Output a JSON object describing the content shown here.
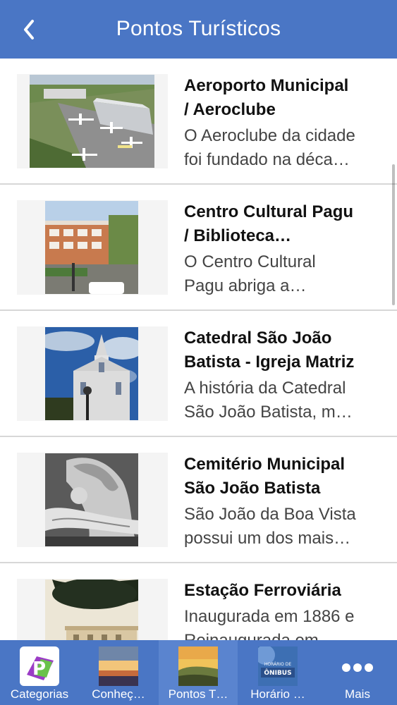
{
  "header": {
    "title": "Pontos Turísticos",
    "back_icon": "chevron-left-icon"
  },
  "items": [
    {
      "title_l1": "Aeroporto Municipal",
      "title_l2": "/ Aeroclube",
      "desc_l1": "O Aeroclube da cidade",
      "desc_l2": "foi fundado na déca…"
    },
    {
      "title_l1": "Centro Cultural Pagu",
      "title_l2": "/ Biblioteca…",
      "desc_l1": "O Centro Cultural",
      "desc_l2": "Pagu abriga a…"
    },
    {
      "title_l1": "Catedral São João",
      "title_l2": "Batista - Igreja Matriz",
      "desc_l1": "A história da Catedral",
      "desc_l2": "São João Batista, m…"
    },
    {
      "title_l1": "Cemitério Municipal",
      "title_l2": "São João Batista",
      "desc_l1": "São João da Boa Vista",
      "desc_l2": "possui um dos mais…"
    },
    {
      "title_l1": "Estação Ferroviária",
      "desc_l1": "Inaugurada em 1886 e",
      "desc_l2": "Reinaugurada em…"
    }
  ],
  "tabs": [
    {
      "label": "Categorias"
    },
    {
      "label": "Conheç…"
    },
    {
      "label": "Pontos T…",
      "active": true
    },
    {
      "label": "Horário …",
      "icon_text": "HORÁRIO DE ÔNIBUS"
    },
    {
      "label": "Mais"
    }
  ],
  "colors": {
    "bar": "#4a76c5",
    "active_tab": "#5a84cf"
  }
}
